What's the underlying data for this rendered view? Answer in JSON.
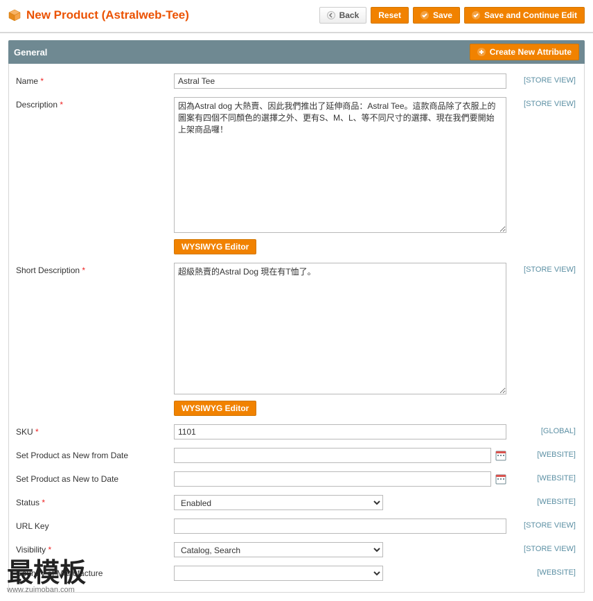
{
  "header": {
    "title": "New Product (Astralweb-Tee)",
    "buttons": {
      "back": "Back",
      "reset": "Reset",
      "save": "Save",
      "save_continue": "Save and Continue Edit"
    }
  },
  "section": {
    "title": "General",
    "create_attr": "Create New Attribute"
  },
  "scopes": {
    "store_view": "[STORE VIEW]",
    "global": "[GLOBAL]",
    "website": "[WEBSITE]"
  },
  "fields": {
    "name": {
      "label": "Name",
      "value": "Astral Tee",
      "scope": "store_view"
    },
    "description": {
      "label": "Description",
      "value": "因為Astral dog 大熱賣、因此我們推出了延伸商品：Astral Tee。這款商品除了衣服上的圖案有四個不同顏色的選擇之外、更有S、M、L、等不同尺寸的選擇、現在我們要開始上架商品囉！",
      "scope": "store_view"
    },
    "short_description": {
      "label": "Short Description",
      "value": "超級熱賣的Astral Dog 現在有T恤了。",
      "scope": "store_view"
    },
    "sku": {
      "label": "SKU",
      "value": "1101",
      "scope": "global"
    },
    "new_from": {
      "label": "Set Product as New from Date",
      "value": "",
      "scope": "website"
    },
    "new_to": {
      "label": "Set Product as New to Date",
      "value": "",
      "scope": "website"
    },
    "status": {
      "label": "Status",
      "value": "Enabled",
      "scope": "website"
    },
    "url_key": {
      "label": "URL Key",
      "value": "",
      "scope": "store_view"
    },
    "visibility": {
      "label": "Visibility",
      "value": "Catalog, Search",
      "scope": "store_view"
    },
    "country_mfr": {
      "label": "Country of Manufacture",
      "value": "",
      "scope": "website"
    }
  },
  "wysiwyg_label": "WYSIWYG Editor",
  "watermark": {
    "big": "最模板",
    "small": "www.zuimoban.com"
  }
}
